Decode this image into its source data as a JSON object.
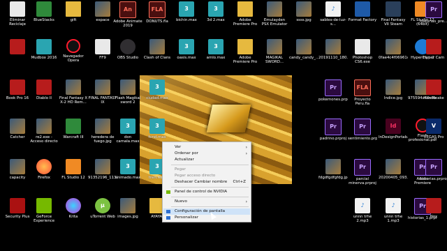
{
  "desktop": {
    "icons": [
      {
        "label": "Eliminar Reciclaje",
        "kind": "file",
        "glyph": ""
      },
      {
        "label": "BlueStacks",
        "kind": "green",
        "glyph": ""
      },
      {
        "label": "gift",
        "kind": "folder",
        "glyph": ""
      },
      {
        "label": "espace",
        "kind": "img",
        "glyph": ""
      },
      {
        "label": "Adobe Animate 2019",
        "kind": "an",
        "glyph": "An"
      },
      {
        "label": "DONUTS.fla",
        "kind": "an",
        "glyph": "FLA"
      },
      {
        "label": "bichin.max",
        "kind": "3ds",
        "glyph": "3"
      },
      {
        "label": "3d 2.max",
        "kind": "3ds",
        "glyph": "3"
      },
      {
        "label": "Adobe Premiere Pro Auto-Save",
        "kind": "folder",
        "glyph": ""
      },
      {
        "label": "Emulayden PSX Emulator Fixed...",
        "kind": "img",
        "glyph": ""
      },
      {
        "label": "ssss.jpg",
        "kind": "img",
        "glyph": ""
      },
      {
        "label": "sables-de-luz-s...",
        "kind": "music",
        "glyph": "♪"
      },
      {
        "label": "Format Factory",
        "kind": "app",
        "glyph": ""
      },
      {
        "label": "Final Fantasy VII Steam Edition",
        "kind": "steam",
        "glyph": ""
      },
      {
        "label": "FL Studio 12 (64bit)",
        "kind": "fl",
        "glyph": ""
      },
      {
        "label": "historias_pre...",
        "kind": "pr",
        "glyph": "Pr"
      },
      {
        "label": "",
        "kind": "red",
        "glyph": ""
      },
      {
        "label": "Mudbox 2016",
        "kind": "3ds",
        "glyph": ""
      },
      {
        "label": "Navegador Opera",
        "kind": "opera",
        "glyph": ""
      },
      {
        "label": "FF9",
        "kind": "file",
        "glyph": ""
      },
      {
        "label": "OBS Studio",
        "kind": "obs",
        "glyph": ""
      },
      {
        "label": "Clash of Clans",
        "kind": "img",
        "glyph": ""
      },
      {
        "label": "oasis.max",
        "kind": "3ds",
        "glyph": "3"
      },
      {
        "label": "amlo.max",
        "kind": "3ds",
        "glyph": "3"
      },
      {
        "label": "Adobe Premiere Pro Audio Previ...",
        "kind": "folder",
        "glyph": ""
      },
      {
        "label": "MAGIKAL SWORD...",
        "kind": "img",
        "glyph": ""
      },
      {
        "label": "candy_candy_...",
        "kind": "img",
        "glyph": ""
      },
      {
        "label": "20191110_180...",
        "kind": "img",
        "glyph": ""
      },
      {
        "label": "Photoshop CS6.exe",
        "kind": "file",
        "glyph": ""
      },
      {
        "label": "0fae4c4f06961c...",
        "kind": "img",
        "glyph": ""
      },
      {
        "label": "HyperCam 2",
        "kind": "hyper",
        "glyph": ""
      },
      {
        "label": "Hyper Cam",
        "kind": "red",
        "glyph": ""
      },
      {
        "label": "Book Pro 16",
        "kind": "red",
        "glyph": ""
      },
      {
        "label": "Diablo II",
        "kind": "red",
        "glyph": ""
      },
      {
        "label": "Final Fantasy X X-2 HD Rem...",
        "kind": "img",
        "glyph": ""
      },
      {
        "label": "FINAL FANTASY IX",
        "kind": "img",
        "glyph": ""
      },
      {
        "label": "Flash Magikal sword 2",
        "kind": "img",
        "glyph": ""
      },
      {
        "label": "ciudad.max",
        "kind": "3ds",
        "glyph": "3"
      },
      {
        "label": "pokemones.prproj",
        "kind": "pr",
        "glyph": "Pr"
      },
      {
        "label": "Proyecto Peru.fla",
        "kind": "an",
        "glyph": "FLA"
      },
      {
        "label": "Indice.jpg",
        "kind": "img",
        "glyph": ""
      },
      {
        "label": "975594a69c9b...",
        "kind": "img",
        "glyph": ""
      },
      {
        "label": "Handbrake",
        "kind": "red",
        "glyph": ""
      },
      {
        "label": "Catcher",
        "kind": "img",
        "glyph": ""
      },
      {
        "label": "re2.exe - Acceso directo",
        "kind": "img",
        "glyph": ""
      },
      {
        "label": "Warcraft III",
        "kind": "green",
        "glyph": ""
      },
      {
        "label": "heredera de fuego.jpg",
        "kind": "img",
        "glyph": ""
      },
      {
        "label": "don camala.max",
        "kind": "3ds",
        "glyph": "3"
      },
      {
        "label": "fond.max",
        "kind": "3ds",
        "glyph": "3"
      },
      {
        "label": "padrino.prproj",
        "kind": "pr",
        "glyph": "Pr"
      },
      {
        "label": "sentimiento.prproj",
        "kind": "pr",
        "glyph": "Pr"
      },
      {
        "label": "InDesignPortab...",
        "kind": "id",
        "glyph": "Id"
      },
      {
        "label": "Flash profesional.pdf",
        "kind": "opera",
        "glyph": ""
      },
      {
        "label": "VEGAS Pro",
        "kind": "vegas",
        "glyph": "V"
      },
      {
        "label": "capacity",
        "kind": "img",
        "glyph": ""
      },
      {
        "label": "Firefox",
        "kind": "firefox",
        "glyph": ""
      },
      {
        "label": "FL Studio 12",
        "kind": "fl",
        "glyph": ""
      },
      {
        "label": "91352196_1137...",
        "kind": "img",
        "glyph": ""
      },
      {
        "label": "animado.max",
        "kind": "3ds",
        "glyph": "3"
      },
      {
        "label": "tren.max",
        "kind": "3ds",
        "glyph": "3"
      },
      {
        "label": "fdgdfgdfgfdg.jpg",
        "kind": "img",
        "glyph": ""
      },
      {
        "label": "parcial minerva.prproj",
        "kind": "pr",
        "glyph": "Pr"
      },
      {
        "label": "20200405_093...",
        "kind": "img",
        "glyph": ""
      },
      {
        "label": "Adobe Premiere Pro.exe -",
        "kind": "pr",
        "glyph": "Pr"
      },
      {
        "label": "historias.prproj",
        "kind": "pr",
        "glyph": "Pr"
      },
      {
        "label": "Security Plus",
        "kind": "shield",
        "glyph": ""
      },
      {
        "label": "GeForce Experience",
        "kind": "geforce",
        "glyph": ""
      },
      {
        "label": "Krita",
        "kind": "krita",
        "glyph": ""
      },
      {
        "label": "uTorrent Web",
        "kind": "utorrent",
        "glyph": "µ"
      },
      {
        "label": "images.jpg",
        "kind": "img",
        "glyph": ""
      },
      {
        "label": "AYAYAI",
        "kind": "folder",
        "glyph": ""
      },
      {
        "label": "unnn trhe 2.mp3",
        "kind": "music",
        "glyph": "♪"
      },
      {
        "label": "unnn trhe 1.mp3",
        "kind": "music",
        "glyph": "♪"
      },
      {
        "label": "historias_1.prproj",
        "kind": "pr",
        "glyph": "Pr"
      },
      {
        "label": "Nox",
        "kind": "red",
        "glyph": ""
      }
    ]
  },
  "context_menu": {
    "items": [
      {
        "label": "Ver",
        "submenu": true
      },
      {
        "label": "Ordenar por",
        "submenu": true
      },
      {
        "label": "Actualizar"
      },
      {
        "label": "Pegar",
        "disabled": true
      },
      {
        "label": "Pegar acceso directo",
        "disabled": true
      },
      {
        "label": "Deshacer Cambiar nombre",
        "shortcut": "Ctrl+Z"
      },
      {
        "label": "Panel de control de NVIDIA",
        "icon": "nvidia-icon"
      },
      {
        "label": "Nuevo",
        "submenu": true
      },
      {
        "label": "Configuración de pantalla",
        "icon": "display-icon",
        "highlighted": true
      },
      {
        "label": "Personalizar",
        "icon": "personalize-icon"
      }
    ]
  },
  "colors": {
    "menu_bg": "#f2f2f2",
    "highlight": "#cfe3f8",
    "desktop_bg": "#000000"
  }
}
